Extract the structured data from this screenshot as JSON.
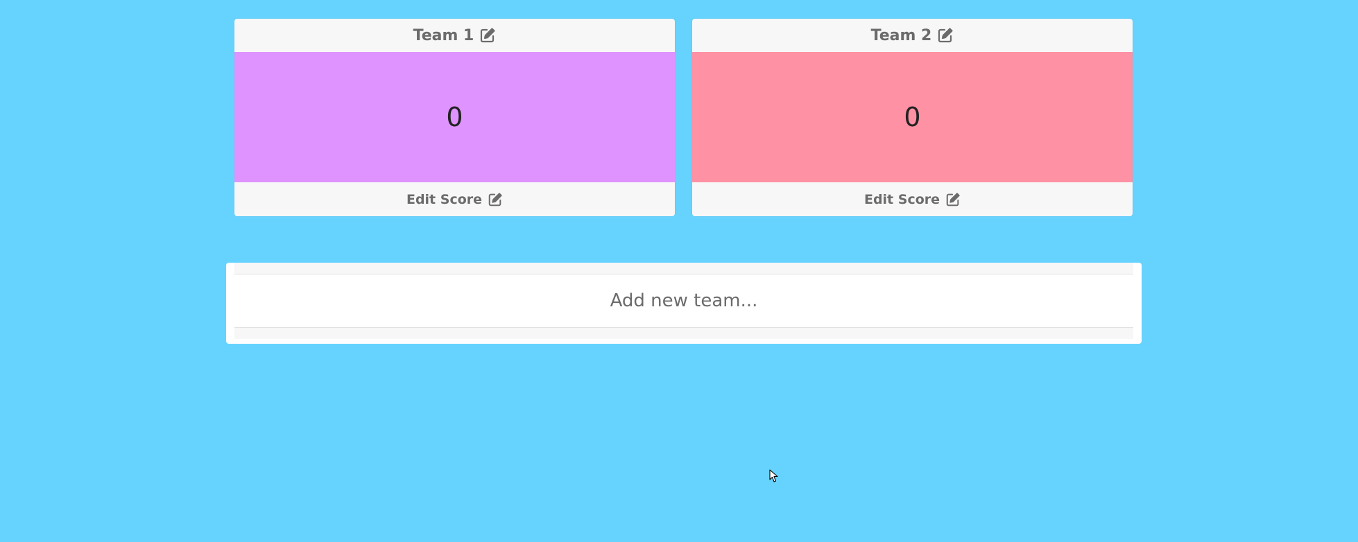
{
  "colors": {
    "background": "#66d3ff",
    "card_bg": "#f7f7f7",
    "team1": "#df93ff",
    "team2": "#ff91a4",
    "muted_text": "#6b6b6b"
  },
  "teams": [
    {
      "name": "Team 1",
      "score": "0",
      "edit_score_label": "Edit Score",
      "name_icon": "edit-icon",
      "score_icon": "edit-icon",
      "color": "#df93ff"
    },
    {
      "name": "Team 2",
      "score": "0",
      "edit_score_label": "Edit Score",
      "name_icon": "edit-icon",
      "score_icon": "edit-icon",
      "color": "#ff91a4"
    }
  ],
  "add_team": {
    "placeholder": "Add new team...",
    "value": ""
  },
  "cursor_icon": "mouse-pointer-icon"
}
